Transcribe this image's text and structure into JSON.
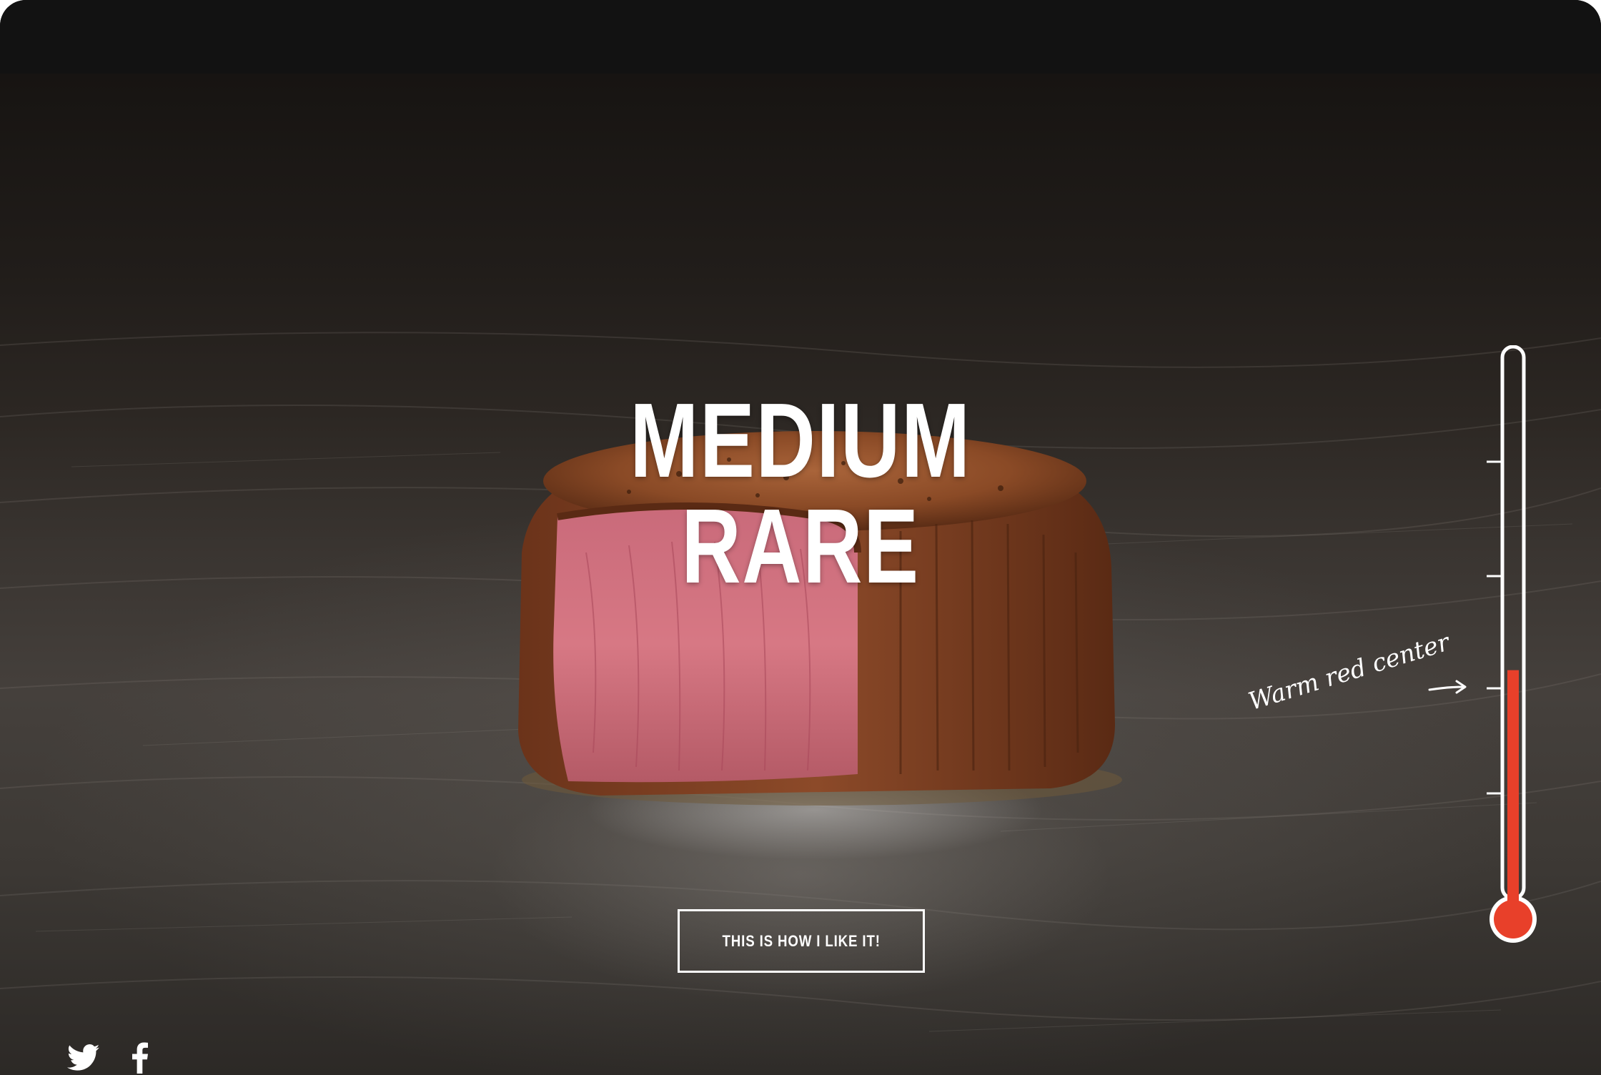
{
  "page": {
    "doneness_title": "MEDIUM RARE",
    "cta_label": "THIS IS HOW I LIKE IT!",
    "thermometer_annotation": "Warm red center",
    "thermometer_fill_fraction": 0.43
  },
  "social": {
    "icons": [
      "twitter-icon",
      "facebook-icon"
    ]
  },
  "colors": {
    "accent_red": "#e8402a",
    "background_dark": "#1b1917",
    "topbar": "#121212",
    "text": "#ffffff"
  }
}
